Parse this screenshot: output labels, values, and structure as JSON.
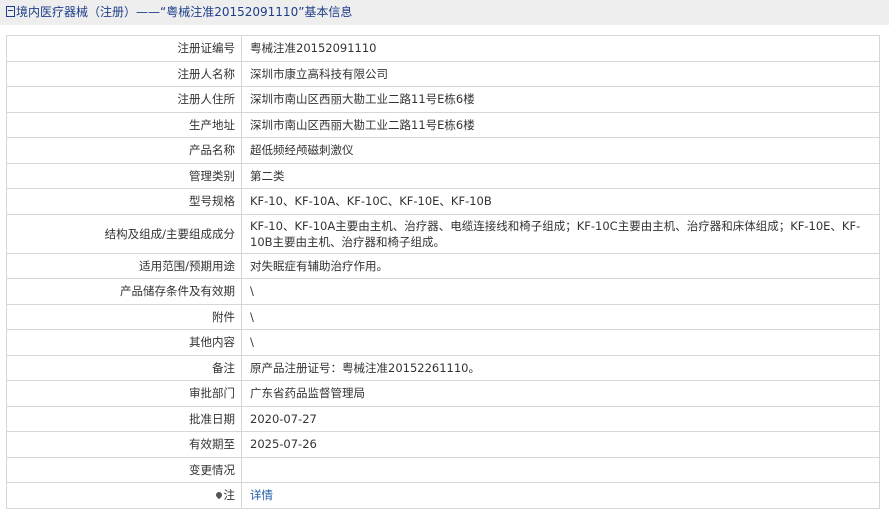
{
  "header": {
    "title": "境内医疗器械（注册）——“粤械注准20152091110”基本信息"
  },
  "rows": [
    {
      "label": "注册证编号",
      "value": "粤械注准20152091110"
    },
    {
      "label": "注册人名称",
      "value": "深圳市康立高科技有限公司"
    },
    {
      "label": "注册人住所",
      "value": "深圳市南山区西丽大勘工业二路11号E栋6楼"
    },
    {
      "label": "生产地址",
      "value": "深圳市南山区西丽大勘工业二路11号E栋6楼"
    },
    {
      "label": "产品名称",
      "value": "超低频经颅磁刺激仪"
    },
    {
      "label": "管理类别",
      "value": "第二类"
    },
    {
      "label": "型号规格",
      "value": "KF-10、KF-10A、KF-10C、KF-10E、KF-10B"
    },
    {
      "label": "结构及组成/主要组成成分",
      "value": "KF-10、KF-10A主要由主机、治疗器、电缆连接线和椅子组成；KF-10C主要由主机、治疗器和床体组成；KF-10E、KF-10B主要由主机、治疗器和椅子组成。"
    },
    {
      "label": "适用范围/预期用途",
      "value": "对失眠症有辅助治疗作用。"
    },
    {
      "label": "产品储存条件及有效期",
      "value": "\\"
    },
    {
      "label": "附件",
      "value": "\\"
    },
    {
      "label": "其他内容",
      "value": "\\"
    },
    {
      "label": "备注",
      "value": "原产品注册证号：粤械注准20152261110。"
    },
    {
      "label": "审批部门",
      "value": "广东省药品监督管理局"
    },
    {
      "label": "批准日期",
      "value": "2020-07-27"
    },
    {
      "label": "有效期至",
      "value": "2025-07-26"
    },
    {
      "label": "变更情况",
      "value": ""
    },
    {
      "label": "注",
      "value": "详情"
    }
  ],
  "icons": {
    "title": "document-icon",
    "note": "pin-icon"
  },
  "colors": {
    "title_text": "#1e3e8a",
    "header_bg": "#eeeeee",
    "border": "#d6d6d6",
    "link": "#1e5aa8"
  }
}
